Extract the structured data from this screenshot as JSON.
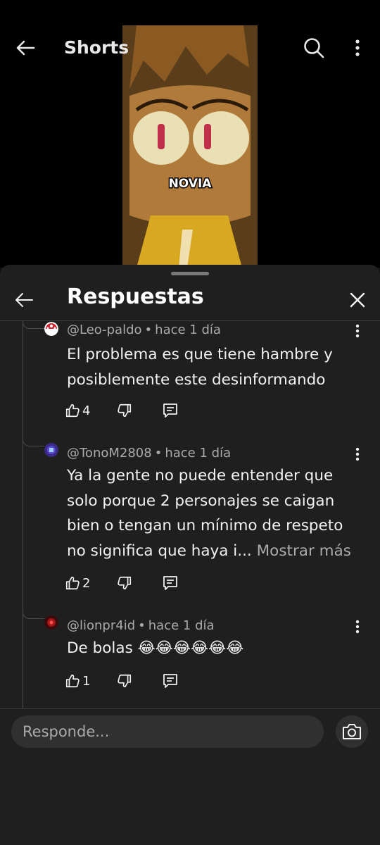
{
  "topbar": {
    "title": "Shorts"
  },
  "video": {
    "overlay_text": "NOVIA"
  },
  "sheet": {
    "title": "Respuestas",
    "comments": [
      {
        "handle": "@Leo-paldo",
        "time": "hace 1 día",
        "text": "El problema es que tiene hambre y posiblemente este desinformando",
        "likes": "4"
      },
      {
        "handle": "@TonoM2808",
        "time": "hace 1 día",
        "text": "Ya la gente no puede entender que solo porque 2 personajes se caigan bien o tengan un mínimo de respeto no significa que haya i...",
        "more": "Mostrar más",
        "likes": "2"
      },
      {
        "handle": "@lionpr4id",
        "time": "hace 1 día",
        "text": "De bolas 😂😂😂😂😂😂",
        "likes": "1"
      }
    ],
    "reply_placeholder": "Responde..."
  },
  "colors": {
    "background": "#0f0f0f",
    "sheet": "#1f1f1f",
    "text": "#f1f1f1",
    "secondary_text": "#aaaaaa",
    "input_bg": "#303030"
  }
}
